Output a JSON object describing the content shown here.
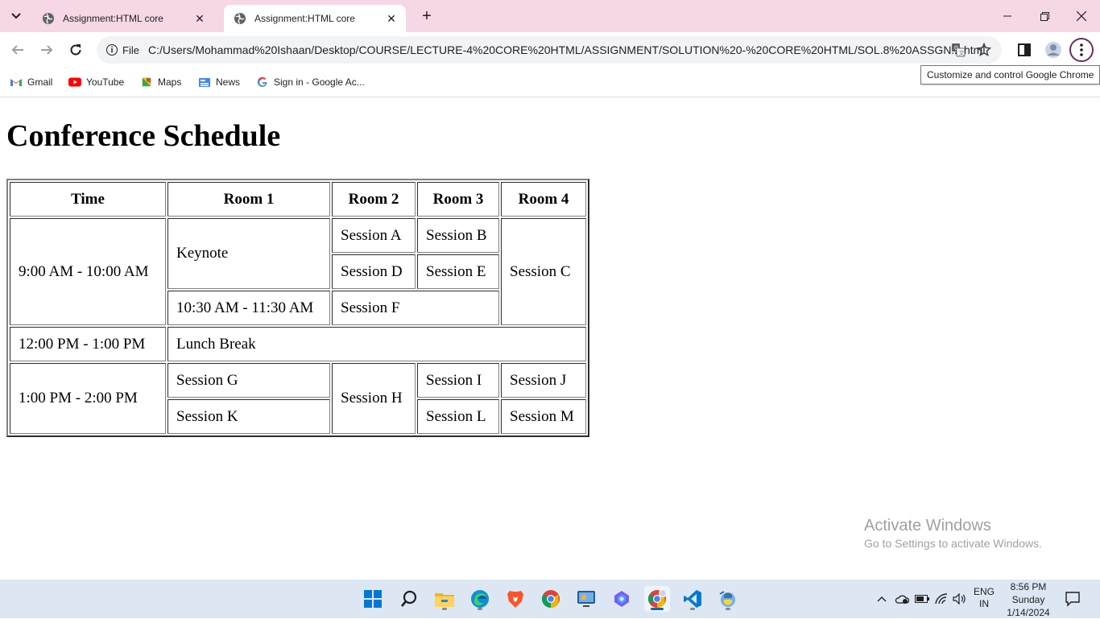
{
  "browser": {
    "tabs": [
      {
        "title": "Assignment:HTML core",
        "active": false
      },
      {
        "title": "Assignment:HTML core",
        "active": true
      }
    ],
    "address": {
      "scheme_label": "File",
      "url": "C:/Users/Mohammad%20Ishaan/Desktop/COURSE/LECTURE-4%20CORE%20HTML/ASSIGNMENT/SOLUTION%20-%20CORE%20HTML/SOL.8%20ASSGN.2.html"
    },
    "tooltip": "Customize and control Google Chrome",
    "bookmarks": [
      "Gmail",
      "YouTube",
      "Maps",
      "News",
      "Sign in - Google Ac..."
    ],
    "colors": {
      "tabstrip": "#f6d7e5",
      "omnibox": "#f1f3f4",
      "menu_ring": "#6b2e57"
    }
  },
  "page": {
    "heading": "Conference Schedule",
    "table": {
      "headers": [
        "Time",
        "Room 1",
        "Room 2",
        "Room 3",
        "Room 4"
      ],
      "cells": {
        "t1": "9:00 AM - 10:00 AM",
        "keynote": "Keynote",
        "a": "Session A",
        "b": "Session B",
        "c": "Session C",
        "d": "Session D",
        "e": "Session E",
        "t2": "10:30 AM - 11:30 AM",
        "f": "Session F",
        "t3": "12:00 PM - 1:00 PM",
        "lunch": "Lunch Break",
        "t4": "1:00 PM - 2:00 PM",
        "g": "Session G",
        "h": "Session H",
        "i": "Session I",
        "j": "Session J",
        "k": "Session K",
        "l": "Session L",
        "m": "Session M"
      }
    }
  },
  "watermark": {
    "title": "Activate Windows",
    "subtitle": "Go to Settings to activate Windows."
  },
  "taskbar": {
    "apps": [
      "start-icon",
      "search-icon",
      "file-explorer-icon",
      "edge-icon",
      "brave-icon",
      "chrome-icon",
      "remote-desktop-icon",
      "copilot-icon",
      "chrome-profile-icon",
      "vscode-icon",
      "python-icon"
    ],
    "language": {
      "line1": "ENG",
      "line2": "IN"
    },
    "clock": {
      "time": "8:56 PM",
      "day": "Sunday",
      "date": "1/14/2024"
    }
  }
}
